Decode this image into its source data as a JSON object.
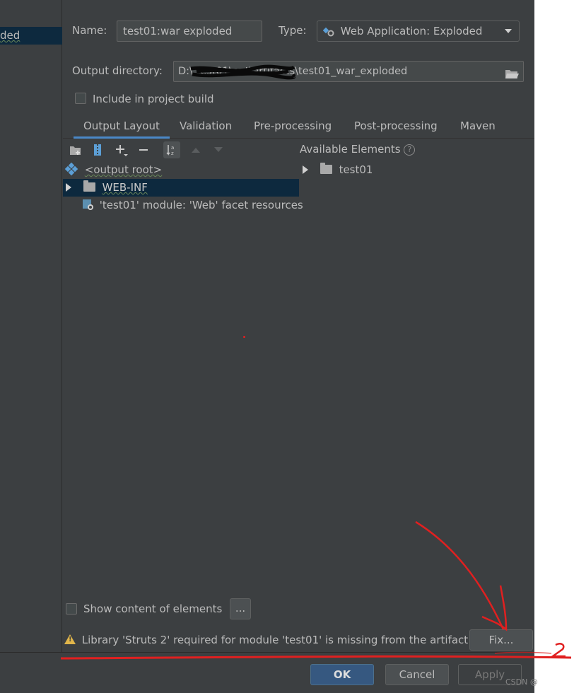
{
  "left": {
    "selected_item": "ded"
  },
  "form": {
    "name_label": "Name:",
    "name_value": "test01:war exploded",
    "type_label": "Type:",
    "type_value": "Web Application: Exploded",
    "output_label": "Output directory:",
    "output_value": "D:\\                              test01\\out\\artifacts\\test01_war_exploded",
    "include_label": "Include in project build"
  },
  "tabs": [
    "Output Layout",
    "Validation",
    "Pre-processing",
    "Post-processing",
    "Maven"
  ],
  "tree": {
    "root": "<output root>",
    "webinf": "WEB-INF",
    "module": "'test01' module: 'Web' facet resources"
  },
  "available": {
    "title": "Available Elements",
    "item": "test01"
  },
  "bottom": {
    "show_content_label": "Show content of elements",
    "ellipsis": "...",
    "warning": "Library 'Struts 2' required for module 'test01' is missing from the artifact",
    "fix": "Fix...",
    "ok": "OK",
    "cancel": "Cancel",
    "apply": "Apply"
  },
  "watermark": "CSDN @",
  "annotation_colors": {
    "red": "#e02020"
  }
}
